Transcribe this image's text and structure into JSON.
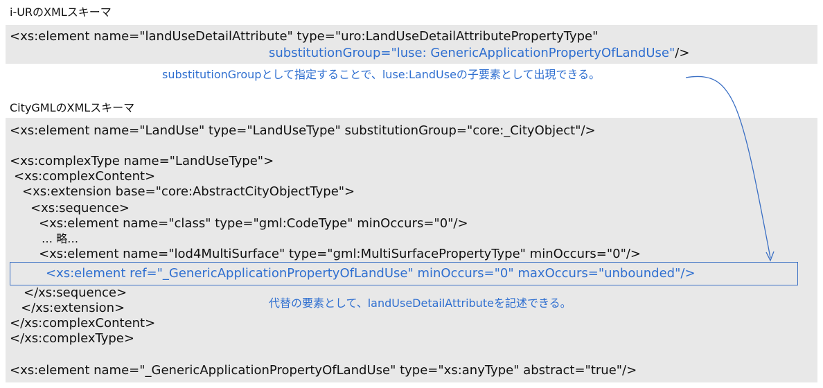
{
  "iur_schema": {
    "title": "i-URのXMLスキーマ",
    "line1": "<xs:element name=\"landUseDetailAttribute\" type=\"uro:LandUseDetailAttributePropertyType\"",
    "line2": "substitutionGroup=\"luse: GenericApplicationPropertyOfLandUse\"",
    "line2_tail": "/>",
    "note": "substitutionGroupとして指定することで、luse:LandUseの子要素として出現できる。"
  },
  "citygml_schema": {
    "title": "CityGMLのXMLスキーマ",
    "lines": [
      "<xs:element name=\"LandUse\" type=\"LandUseType\" substitutionGroup=\"core:_CityObject\"/>",
      "<xs:complexType name=\"LandUseType\">",
      " <xs:complexContent>",
      "  <xs:extension base=\"core:AbstractCityObjectType\">",
      "   <xs:sequence>",
      "    <xs:element name=\"class\" type=\"gml:CodeType\" minOccurs=\"0\"/>",
      "     … 略…",
      "    <xs:element name=\"lod4MultiSurface\" type=\"gml:MultiSurfacePropertyType\" minOccurs=\"0\"/>",
      "<xs:element ref=\"_GenericApplicationPropertyOfLandUse\" minOccurs=\"0\" maxOccurs=\"unbounded\"/>",
      "    </xs:sequence>",
      "  </xs:extension>",
      "</xs:complexContent>",
      "</xs:complexType>",
      "<xs:element name=\"_GenericApplicationPropertyOfLandUse\" type=\"xs:anyType\" abstract=\"true\"/>"
    ],
    "note": "代替の要素として、landUseDetailAttributeを記述できる。"
  },
  "colors": {
    "accent_blue": "#2f6fd0",
    "code_background": "#e8e8e8"
  }
}
